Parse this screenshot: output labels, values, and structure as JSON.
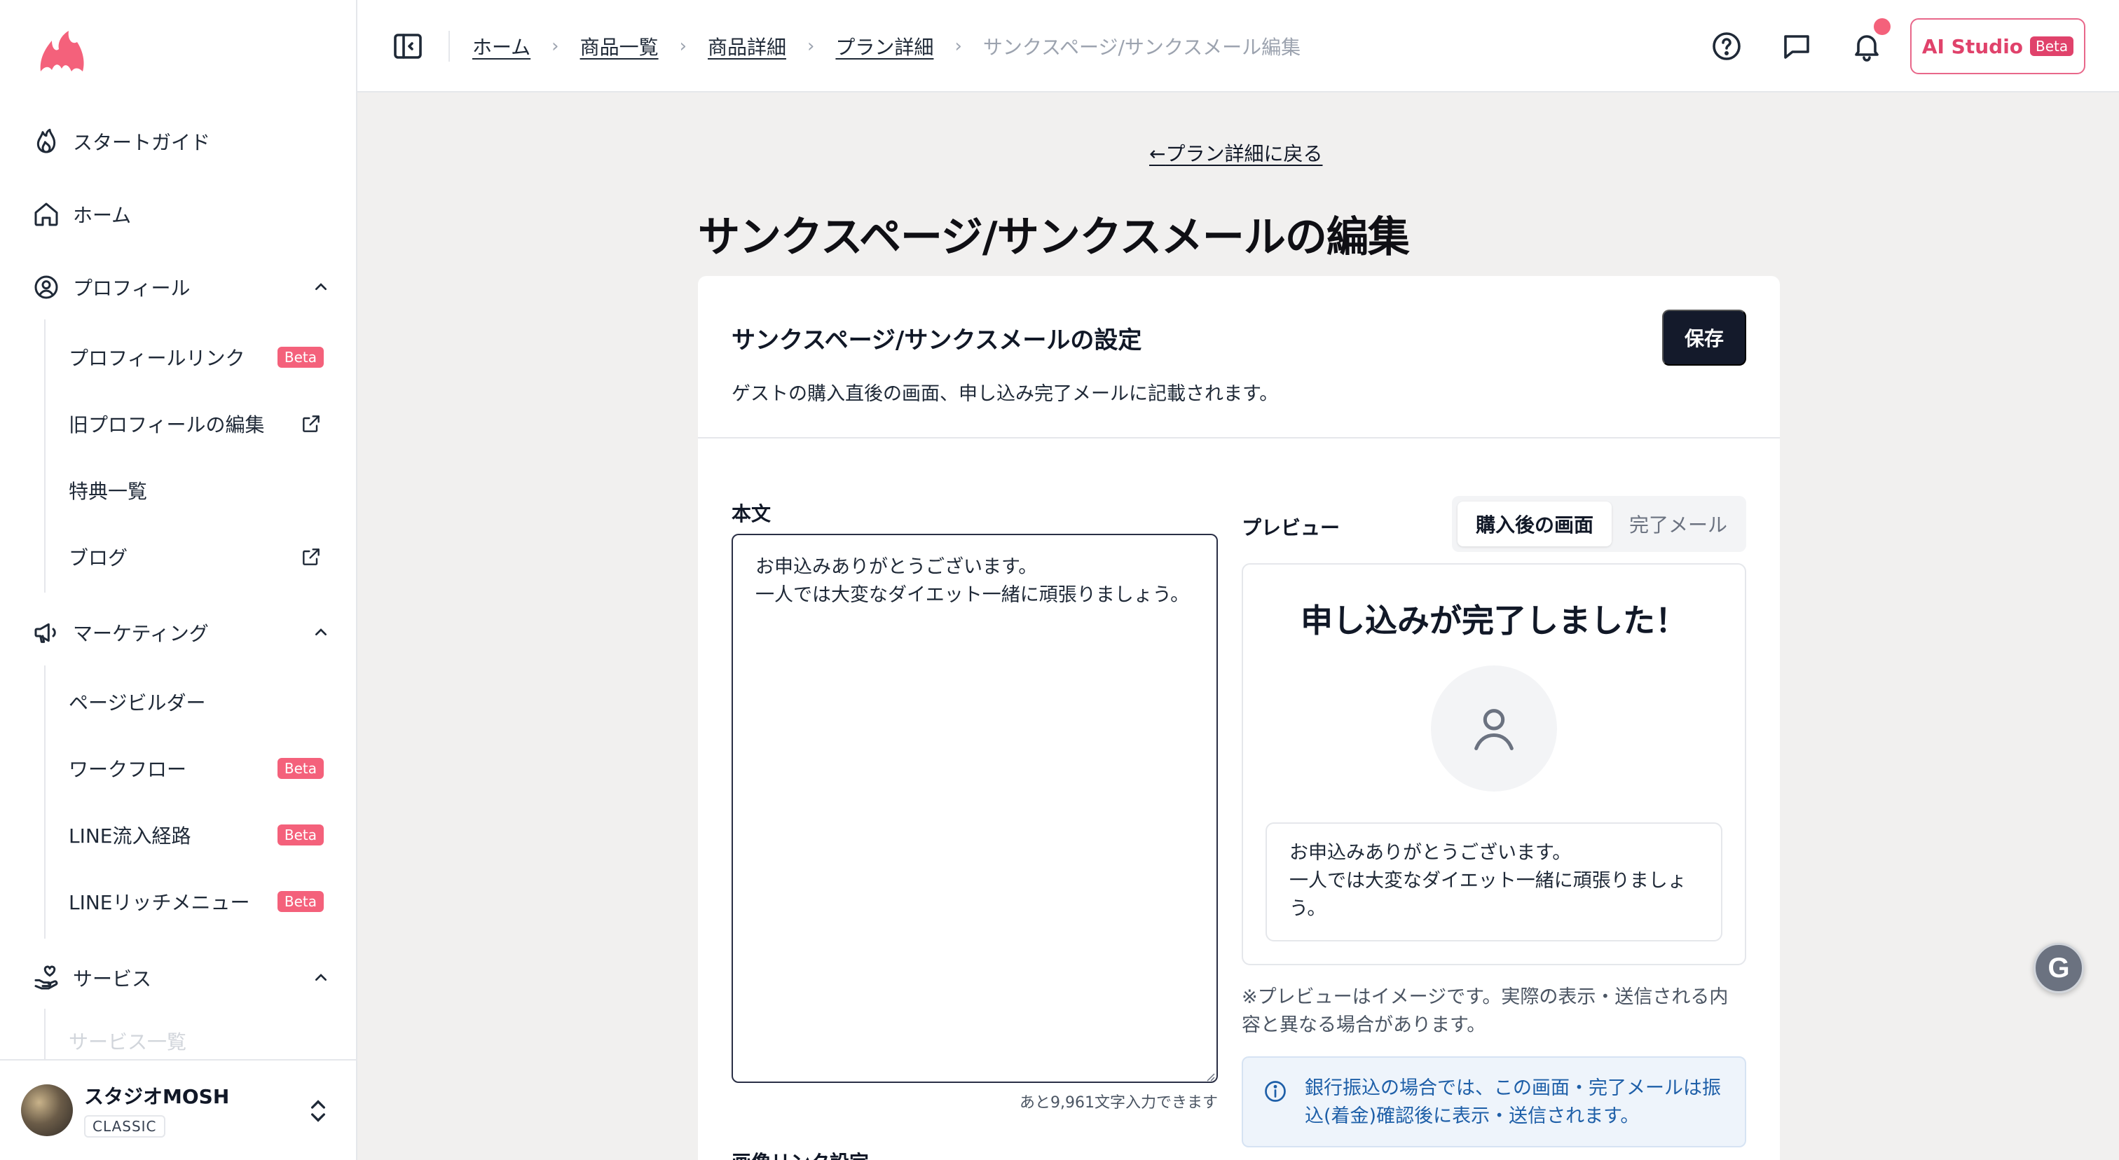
{
  "colors": {
    "brand": "#f4617b",
    "primary_button": "#141a2b",
    "ai_accent": "#e0426b",
    "info_text": "#1e5fa8"
  },
  "sidebar": {
    "logo_icon": "flame-logo-icon",
    "items": [
      {
        "label": "スタートガイド",
        "icon": "flame-icon"
      },
      {
        "label": "ホーム",
        "icon": "home-icon"
      },
      {
        "label": "プロフィール",
        "icon": "user-circle-icon",
        "expanded": true,
        "children": [
          {
            "label": "プロフィールリンク",
            "badge": "Beta"
          },
          {
            "label": "旧プロフィールの編集",
            "external": true
          },
          {
            "label": "特典一覧"
          },
          {
            "label": "ブログ",
            "external": true
          }
        ]
      },
      {
        "label": "マーケティング",
        "icon": "megaphone-icon",
        "expanded": true,
        "children": [
          {
            "label": "ページビルダー"
          },
          {
            "label": "ワークフロー",
            "badge": "Beta"
          },
          {
            "label": "LINE流入経路",
            "badge": "Beta"
          },
          {
            "label": "LINEリッチメニュー",
            "badge": "Beta"
          }
        ]
      },
      {
        "label": "サービス",
        "icon": "hand-heart-icon",
        "expanded": true,
        "children": [
          {
            "label": "サービス一覧"
          }
        ]
      }
    ],
    "user": {
      "name": "スタジオMOSH",
      "plan": "CLASSIC"
    }
  },
  "topbar": {
    "breadcrumb": [
      "ホーム",
      "商品一覧",
      "商品詳細",
      "プラン詳細"
    ],
    "breadcrumb_current": "サンクスページ/サンクスメール編集",
    "ai_button": {
      "label": "AI Studio",
      "badge": "Beta"
    }
  },
  "main": {
    "back_link": "プラン詳細に戻る",
    "page_title": "サンクスページ/サンクスメールの編集",
    "card": {
      "title": "サンクスページ/サンクスメールの設定",
      "description": "ゲストの購入直後の画面、申し込み完了メールに記載されます。",
      "save_label": "保存",
      "body_label": "本文",
      "body_value": "お申込みありがとうございます。\n一人では大変なダイエット一緒に頑張りましょう。",
      "char_count": "あと9,961文字入力できます",
      "next_section_label": "画像リンク設定",
      "preview": {
        "label": "プレビュー",
        "tabs": [
          "購入後の画面",
          "完了メール"
        ],
        "active_tab": 0,
        "heading": "申し込みが完了しました！",
        "message": "お申込みありがとうございます。\n一人では大変なダイエット一緒に頑張りましょう。",
        "note": "※プレビューはイメージです。実際の表示・送信される内容と異なる場合があります。"
      },
      "info": "銀行振込の場合では、この画面・完了メールは振込(着金)確認後に表示・送信されます。"
    }
  }
}
